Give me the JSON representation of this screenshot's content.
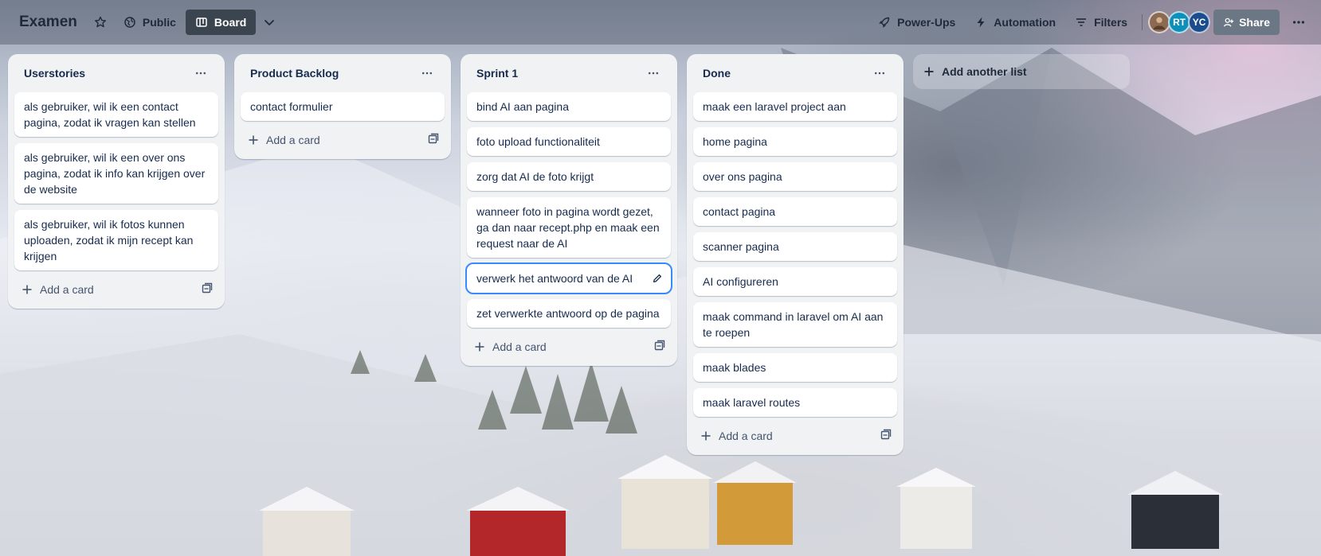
{
  "header": {
    "board_title": "Examen",
    "visibility_label": "Public",
    "view_label": "Board",
    "powerups_label": "Power-Ups",
    "automation_label": "Automation",
    "filters_label": "Filters",
    "share_label": "Share",
    "members": [
      {
        "initials": "",
        "color": "#8a6a52"
      },
      {
        "initials": "RT",
        "color": "#0c8fb8"
      },
      {
        "initials": "YC",
        "color": "#1b4d8c"
      }
    ]
  },
  "lists": [
    {
      "title": "Userstories",
      "cards": [
        "als gebruiker, wil ik een contact pagina, zodat ik vragen kan stellen",
        "als gebruiker, wil ik een over ons pagina, zodat ik info kan krijgen over de website",
        "als gebruiker, wil ik fotos kunnen uploaden, zodat ik mijn recept kan krijgen"
      ],
      "add_card_label": "Add a card"
    },
    {
      "title": "Product Backlog",
      "cards": [
        "contact formulier"
      ],
      "add_card_label": "Add a card"
    },
    {
      "title": "Sprint 1",
      "cards": [
        "bind AI aan pagina",
        "foto upload functionaliteit",
        "zorg dat AI de foto krijgt",
        "wanneer foto in pagina wordt gezet, ga dan naar recept.php en maak een request naar de AI",
        "verwerk het antwoord van de AI",
        "zet verwerkte antwoord op de pagina"
      ],
      "editing_card_index": 4,
      "add_card_label": "Add a card"
    },
    {
      "title": "Done",
      "cards": [
        "maak een laravel project aan",
        "home pagina",
        "over ons pagina",
        "contact pagina",
        "scanner pagina",
        "AI configureren",
        "maak command in laravel om AI aan te roepen",
        "maak blades",
        "maak laravel routes"
      ],
      "add_card_label": "Add a card"
    }
  ],
  "add_list_label": "Add another list"
}
